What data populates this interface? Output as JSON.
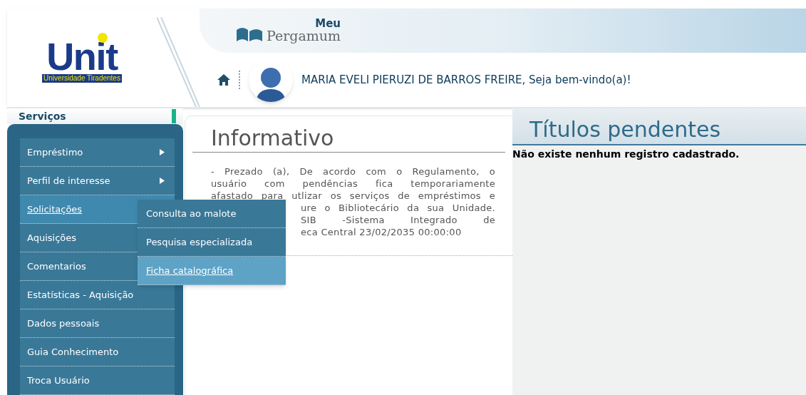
{
  "header": {
    "logo": {
      "word": "Unit",
      "subtitle": "Universidade Tiradentes"
    },
    "brand": {
      "top": "Meu",
      "name": "Pergamum"
    },
    "welcome": "MARIA EVELI PIERUZI DE BARROS FREIRE, Seja bem-vindo(a)!"
  },
  "sidebar": {
    "title": "Serviços",
    "items": [
      {
        "label": "Empréstimo",
        "submenu": true,
        "selected": false
      },
      {
        "label": "Perfil de interesse",
        "submenu": true,
        "selected": false
      },
      {
        "label": "Solicitações",
        "submenu": false,
        "selected": true,
        "children": [
          {
            "label": "Consulta ao malote",
            "selected": false
          },
          {
            "label": "Pesquisa especializada",
            "selected": false
          },
          {
            "label": "Ficha catalográfica",
            "selected": true
          }
        ]
      },
      {
        "label": "Aquisições",
        "submenu": false,
        "selected": false
      },
      {
        "label": "Comentarios",
        "submenu": false,
        "selected": false
      },
      {
        "label": "Estatísticas - Aquisição",
        "submenu": false,
        "selected": false
      },
      {
        "label": "Dados pessoais",
        "submenu": false,
        "selected": false
      },
      {
        "label": "Guia Conhecimento",
        "submenu": false,
        "selected": false
      },
      {
        "label": "Troca Usuário",
        "submenu": false,
        "selected": false
      }
    ]
  },
  "informativo": {
    "title": "Informativo",
    "lines": [
      "- Prezado (a), De acordo com o Regulamento, o",
      "usuário com pendências fica temporariamente",
      "afastado para utlizar os serviços de empréstimos e"
    ],
    "covered_lines": [
      "ure o Bibliotecário da sua Unidade.",
      "SIB -Sistema Integrado de",
      "eca Central 23/02/2035 00:00:00"
    ]
  },
  "pendentes": {
    "title": "Títulos pendentes",
    "message": "Não existe nenhum registro cadastrado."
  }
}
